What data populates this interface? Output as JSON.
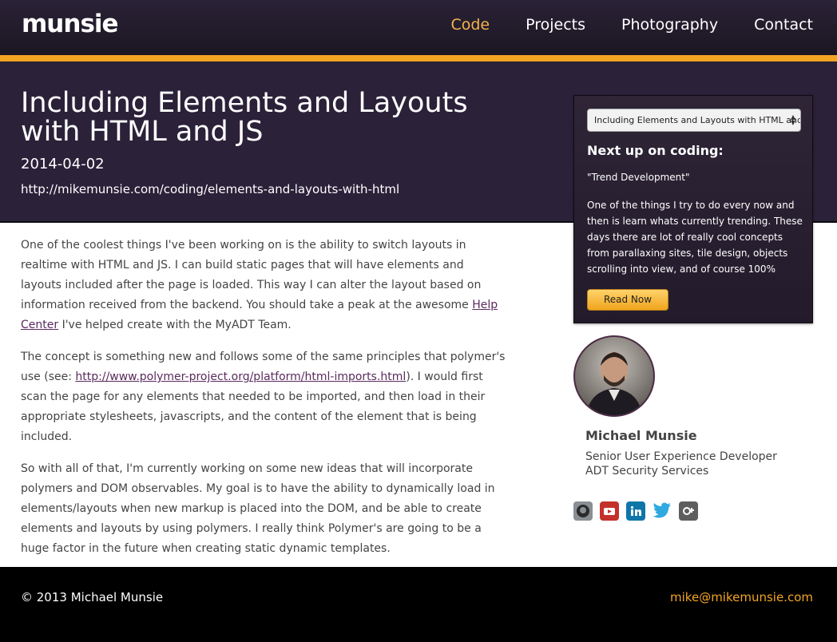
{
  "header": {
    "logo": "munsie",
    "nav": [
      "Code",
      "Projects",
      "Photography",
      "Contact"
    ],
    "active": "Code",
    "accent_color": "#f2a423"
  },
  "post": {
    "title": "Including Elements and Layouts with HTML and JS",
    "date": "2014-04-02",
    "url": "http://mikemunsie.com/coding/elements-and-layouts-with-html",
    "p1_before": "One of the coolest things I've been working on is the ability to switch layouts in realtime with HTML and JS. I can build static pages that will have elements and layouts included after the page is loaded. This way I can alter the layout based on information received from the backend. You should take a peak at the awesome ",
    "p1_link": "Help Center",
    "p1_after": " I've helped create with the MyADT Team.",
    "p2_before": "The concept is something new and follows some of the same principles that polymer's use (see: ",
    "p2_link": "http://www.polymer-project.org/platform/html-imports.html",
    "p2_after": "). I would first scan the page for any elements that needed to be imported, and then load in their appropriate stylesheets, javascripts, and the content of the element that is being included.",
    "p3": "So with all of that, I'm currently working on some new ideas that will incorporate polymers and DOM observables. My goal is to have the ability to dynamically load in elements/layouts when new markup is placed into the DOM, and be able to create elements and layouts by using polymers. I really think Polymer's are going to be a huge factor in the future when creating static dynamic templates."
  },
  "next_up": {
    "select_value": "Including Elements and Layouts with HTML and JS",
    "heading": "Next up on coding:",
    "quote": "\"Trend Development\"",
    "text": "One of the things I try to do every now and then is learn whats currently trending. These days there are lot of really cool concepts from parallaxing sites, tile design, objects scrolling into view, and of course 100%",
    "button": "Read Now"
  },
  "profile": {
    "name": "Michael Munsie",
    "role": "Senior User Experience Developer",
    "company": "ADT Security Services",
    "social_icons": [
      "github-icon",
      "youtube-icon",
      "linkedin-icon",
      "twitter-icon",
      "google-plus-icon"
    ]
  },
  "footer": {
    "copyright": "© 2013 Michael Munsie",
    "email": "mike@mikemunsie.com"
  }
}
